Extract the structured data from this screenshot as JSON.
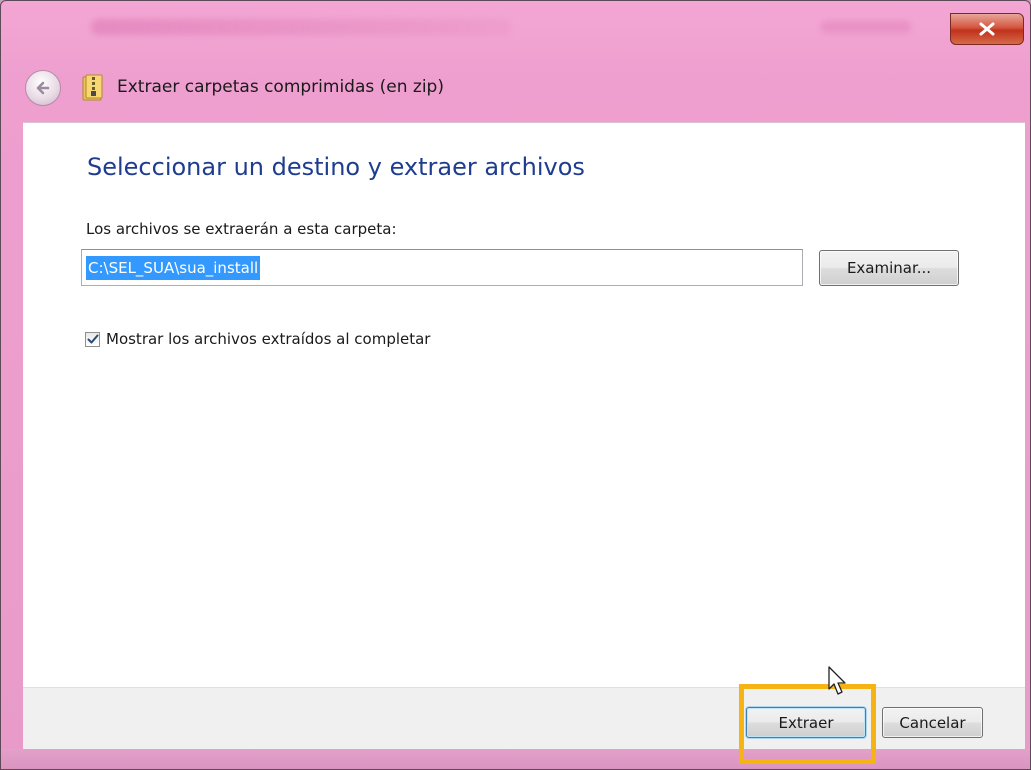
{
  "window": {
    "close_glyph": "x"
  },
  "nav": {
    "title": "Extraer carpetas comprimidas (en zip)",
    "back_icon": "back-arrow-icon",
    "folder_icon": "zip-folder-icon"
  },
  "content": {
    "heading": "Seleccionar un destino y extraer archivos",
    "path_label": "Los archivos se extraerán a esta carpeta:",
    "path_value": "C:\\SEL_SUA\\sua_install",
    "browse_label": "Examinar...",
    "show_files_label": "Mostrar los archivos extraídos al completar",
    "show_files_checked": true
  },
  "footer": {
    "extract_label": "Extraer",
    "cancel_label": "Cancelar"
  },
  "colors": {
    "title_glass": "#ee9fcf",
    "heading": "#1e3d8f",
    "selection": "#3399ff",
    "highlight": "#f5b414"
  }
}
